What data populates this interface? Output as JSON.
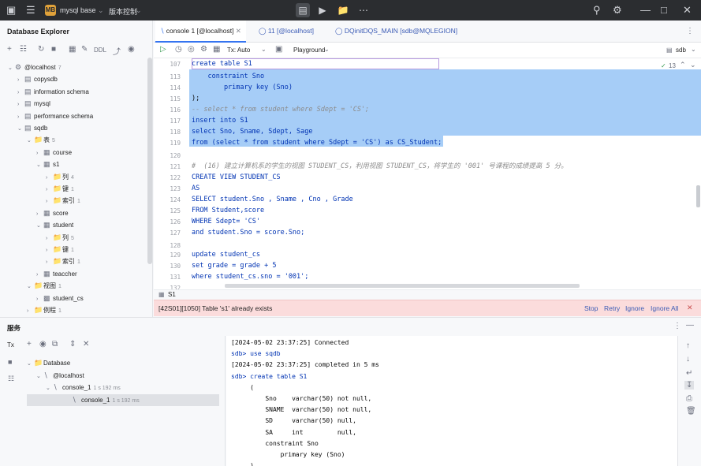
{
  "titlebar": {
    "project_badge": "MB",
    "project_name": "mysql base",
    "vcs_label": "版本控制"
  },
  "left_panel": {
    "title": "Database Explorer",
    "toolbar_ddl": "DDL",
    "tree": [
      {
        "label": "@localhost",
        "count": "7"
      },
      {
        "label": "copysdb",
        "count": ""
      },
      {
        "label": "information schema",
        "count": ""
      },
      {
        "label": "mysql",
        "count": ""
      },
      {
        "label": "performance schema",
        "count": ""
      },
      {
        "label": "sqdb",
        "count": ""
      },
      {
        "label": "表",
        "count": "5"
      },
      {
        "label": "course",
        "count": ""
      },
      {
        "label": "s1",
        "count": ""
      },
      {
        "label": "列",
        "count": "4"
      },
      {
        "label": "键",
        "count": "1"
      },
      {
        "label": "索引",
        "count": "1"
      },
      {
        "label": "score",
        "count": ""
      },
      {
        "label": "student",
        "count": ""
      },
      {
        "label": "列",
        "count": "5"
      },
      {
        "label": "键",
        "count": "1"
      },
      {
        "label": "索引",
        "count": "1"
      },
      {
        "label": "teaccher",
        "count": ""
      },
      {
        "label": "视图",
        "count": "1"
      },
      {
        "label": "student_cs",
        "count": ""
      },
      {
        "label": "例程",
        "count": "1"
      }
    ]
  },
  "tabs": [
    {
      "label": "console 1 [@localhost]"
    },
    {
      "label": "11 [@localhost]"
    },
    {
      "label": "DQinitDQS_MAIN [sdb@MQLEGION]"
    }
  ],
  "editor_toolbar": {
    "tx_label": "Tx: Auto",
    "playground_label": "Playground",
    "schema_label": "sdb",
    "inspection_count": "13"
  },
  "editor": {
    "line_numbers": [
      "107",
      "113",
      "114",
      "115",
      "116",
      "117",
      "118",
      "119",
      "120",
      "121",
      "122",
      "123",
      "124",
      "125",
      "126",
      "127",
      "128",
      "129",
      "130",
      "131",
      "132"
    ],
    "lines": [
      "create table S1",
      "    constraint Sno",
      "        primary key (Sno)",
      ");",
      "-- select * from student where Sdept = 'CS';",
      "insert into S1",
      "select Sno, Sname, Sdept, Sage",
      "from (select * from student where Sdept = 'CS') as CS_Student;",
      "",
      "#  (16) 建立计算机系的学生的视图 STUDENT_CS，利用视图 STUDENT_CS，将学生的 '001' 号课程的成绩提高 5 分。",
      "CREATE VIEW STUDENT_CS",
      "AS",
      "SELECT student.Sno , Sname , Cno , Grade",
      "FROM Student,score",
      "WHERE Sdept= 'CS'",
      "and student.Sno = score.Sno;",
      "",
      "update student_cs",
      "set grade = grade + 5",
      "where student_cs.sno = '001';",
      ""
    ],
    "result_tab": "S1"
  },
  "error_bar": {
    "message": "[42S01][1050] Table 's1' already exists",
    "stop": "Stop",
    "retry": "Retry",
    "ignore": "Ignore",
    "ignore_all": "Ignore All"
  },
  "services": {
    "title": "服务",
    "tx_label": "Tx",
    "tree": [
      {
        "label": "Database",
        "meta": ""
      },
      {
        "label": "@localhost",
        "meta": ""
      },
      {
        "label": "console_1",
        "meta": "1 s 192 ms"
      },
      {
        "label": "console_1",
        "meta": "1 s 192 ms"
      }
    ]
  },
  "console_output": [
    "[2024-05-02 23:37:25] Connected",
    "sdb> use sqdb",
    "[2024-05-02 23:37:25] completed in 5 ms",
    "sdb> create table S1",
    "     (",
    "         Sno    varchar(50) not null,",
    "         SNAME  varchar(50) not null,",
    "         SD     varchar(50) null,",
    "         SA     int         null,",
    "         constraint Sno",
    "             primary key (Sno)",
    "     )"
  ]
}
